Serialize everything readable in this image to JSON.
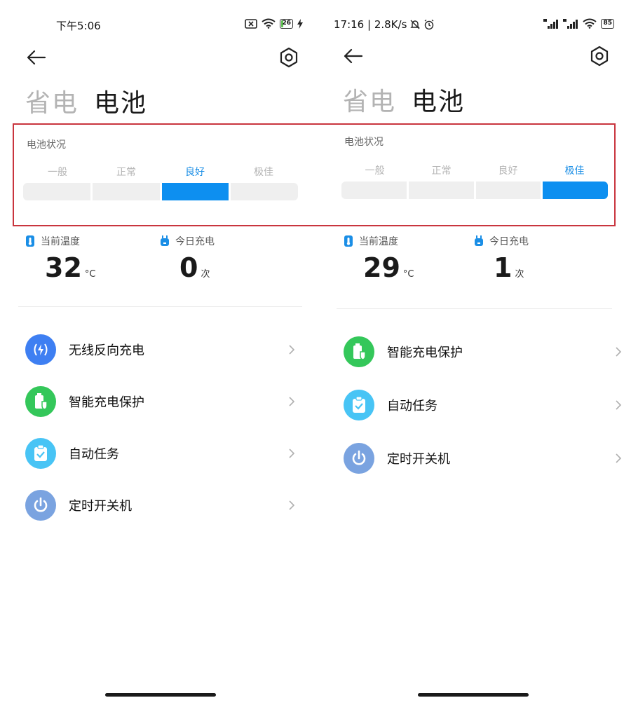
{
  "colors": {
    "accent": "#0d8ff0",
    "highlight_border": "#c9353e"
  },
  "left": {
    "status": {
      "time": "下午5:06",
      "battery_level": "26",
      "battery_fill_fraction": 0.26
    },
    "title_inactive": "省电",
    "title_active": "电池",
    "health": {
      "label": "电池状况",
      "levels": [
        "一般",
        "正常",
        "良好",
        "极佳"
      ],
      "active_index": 2
    },
    "stats": {
      "temp_label": "当前温度",
      "temp_value": "32",
      "temp_unit": "°C",
      "charge_label": "今日充电",
      "charge_value": "0",
      "charge_unit": "次"
    },
    "items": [
      {
        "label": "无线反向充电",
        "icon": "wireless-charge-icon",
        "color": "#3e7ff2"
      },
      {
        "label": "智能充电保护",
        "icon": "battery-shield-icon",
        "color": "#34c75a"
      },
      {
        "label": "自动任务",
        "icon": "clipboard-check-icon",
        "color": "#48c4f5"
      },
      {
        "label": "定时开关机",
        "icon": "power-icon",
        "color": "#7aa3e0"
      }
    ]
  },
  "right": {
    "status": {
      "time_speed": "17:16 | 2.8K/s",
      "battery_level": "85"
    },
    "title_inactive": "省电",
    "title_active": "电池",
    "health": {
      "label": "电池状况",
      "levels": [
        "一般",
        "正常",
        "良好",
        "极佳"
      ],
      "active_index": 3
    },
    "stats": {
      "temp_label": "当前温度",
      "temp_value": "29",
      "temp_unit": "°C",
      "charge_label": "今日充电",
      "charge_value": "1",
      "charge_unit": "次"
    },
    "items": [
      {
        "label": "智能充电保护",
        "icon": "battery-shield-icon",
        "color": "#34c75a"
      },
      {
        "label": "自动任务",
        "icon": "clipboard-check-icon",
        "color": "#48c4f5"
      },
      {
        "label": "定时开关机",
        "icon": "power-icon",
        "color": "#7aa3e0"
      }
    ]
  }
}
